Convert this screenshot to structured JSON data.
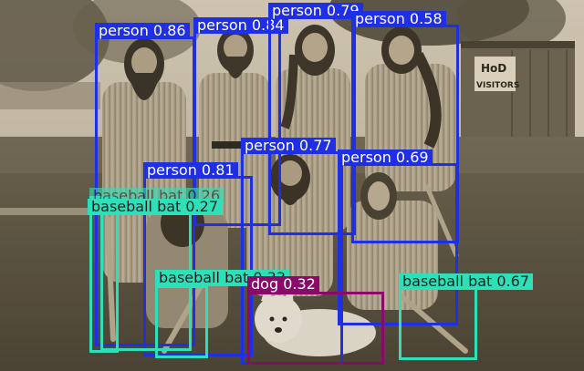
{
  "image": {
    "description_icon": "sepia-photo-bearded-baseball-team-with-dog"
  },
  "colors": {
    "person": "#1f2fe6",
    "baseball_bat": "#2ee0b8",
    "dog": "#8a0a6a",
    "label_text_light": "#ffffff",
    "label_text_dark": "#222222"
  },
  "detections": [
    {
      "id": "p1",
      "label": "person 0.86",
      "class": "person"
    },
    {
      "id": "p2",
      "label": "person 0.84",
      "class": "person"
    },
    {
      "id": "p3",
      "label": "person 0.79",
      "class": "person"
    },
    {
      "id": "p4",
      "label": "person 0.58",
      "class": "person"
    },
    {
      "id": "p5",
      "label": "person 0.77",
      "class": "person"
    },
    {
      "id": "p6",
      "label": "person 0.81",
      "class": "person"
    },
    {
      "id": "p7",
      "label": "person 0.69",
      "class": "person"
    },
    {
      "id": "b1",
      "label": "baseball bat 0.26",
      "class": "baseball_bat"
    },
    {
      "id": "b2",
      "label": "baseball bat 0.27",
      "class": "baseball_bat"
    },
    {
      "id": "b3",
      "label": "baseball bat 0.33",
      "class": "baseball_bat"
    },
    {
      "id": "b4",
      "label": "baseball bat 0.67",
      "class": "baseball_bat"
    },
    {
      "id": "d1",
      "label": "dog 0.32",
      "class": "dog"
    }
  ],
  "background_signs": {
    "sign1": "HoD",
    "sign2": "VISITORS"
  }
}
